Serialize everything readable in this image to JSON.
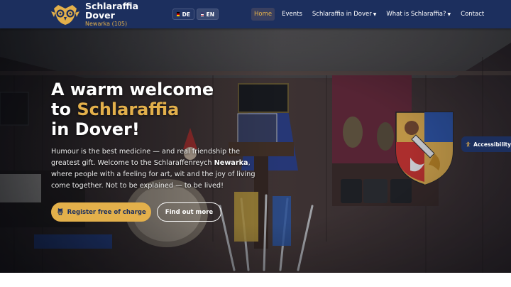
{
  "header": {
    "brand_title_line1": "Schlaraffia",
    "brand_title_line2": "Dover",
    "brand_subtitle": "Newarka (105)",
    "languages": [
      {
        "code": "DE",
        "active": false
      },
      {
        "code": "EN",
        "active": true
      }
    ],
    "nav": [
      {
        "label": "Home",
        "active": true
      },
      {
        "label": "Events"
      },
      {
        "label": "Schlaraffia in Dover",
        "dropdown": true
      },
      {
        "label": "What is Schlaraffia?",
        "dropdown": true
      },
      {
        "label": "Contact"
      }
    ]
  },
  "hero": {
    "headline_line1": "A warm welcome",
    "headline_to": "to",
    "headline_accent": "Schlaraffia",
    "headline_line3": "in Dover!",
    "intro_part1": "Humour is the best medicine — and real friendship the greatest gift. Welcome to the Schlaraffenreych",
    "intro_bold": "Newarka",
    "intro_part2": ", where people with a feeling for art, wit and the joy of living come together. Not to be explained — to be lived!",
    "primary_button": "Register free of charge",
    "secondary_button": "Find out more"
  },
  "accessibility_label": "Accessibility",
  "colors": {
    "navy": "#1c2f5e",
    "gold": "#e3b04b"
  }
}
